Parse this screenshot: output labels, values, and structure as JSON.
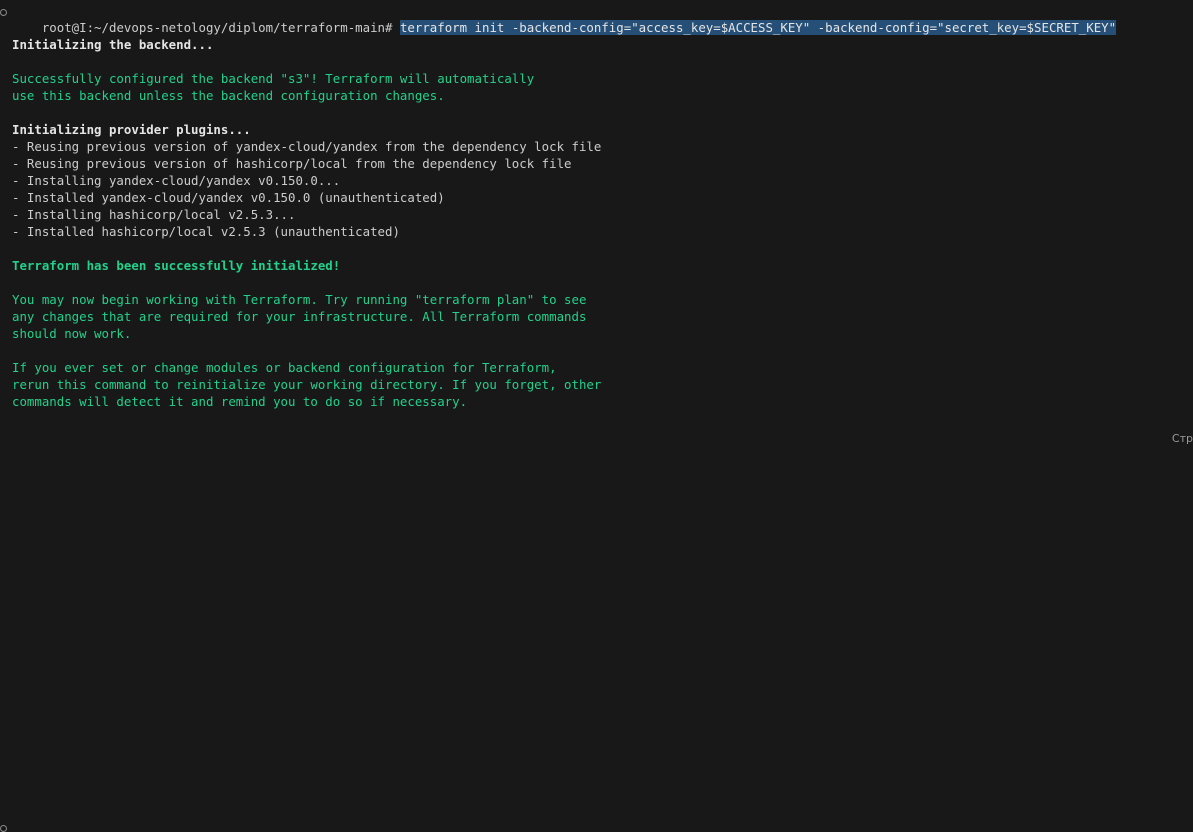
{
  "terminal": {
    "prompt": "root@I:~/devops-netology/diplom/terraform-main#",
    "command": "terraform init -backend-config=\"access_key=$ACCESS_KEY\" -backend-config=\"secret_key=$SECRET_KEY\"",
    "init_backend": "Initializing the backend...",
    "backend_ok_1": "Successfully configured the backend \"s3\"! Terraform will automatically",
    "backend_ok_2": "use this backend unless the backend configuration changes.",
    "init_plugins": "Initializing provider plugins...",
    "plugin_1": "- Reusing previous version of yandex-cloud/yandex from the dependency lock file",
    "plugin_2": "- Reusing previous version of hashicorp/local from the dependency lock file",
    "plugin_3": "- Installing yandex-cloud/yandex v0.150.0...",
    "plugin_4": "- Installed yandex-cloud/yandex v0.150.0 (unauthenticated)",
    "plugin_5": "- Installing hashicorp/local v2.5.3...",
    "plugin_6": "- Installed hashicorp/local v2.5.3 (unauthenticated)",
    "success": "Terraform has been successfully initialized!",
    "next_1": "You may now begin working with Terraform. Try running \"terraform plan\" to see",
    "next_2": "any changes that are required for your infrastructure. All Terraform commands",
    "next_3": "should now work.",
    "reinit_1": "If you ever set or change modules or backend configuration for Terraform,",
    "reinit_2": "rerun this command to reinitialize your working directory. If you forget, other",
    "reinit_3": "commands will detect it and remind you to do so if necessary."
  },
  "status_bar": {
    "partial_label": "Стр"
  },
  "colors": {
    "background": "#181818",
    "green_text": "#23d18b",
    "selection": "#264f78"
  }
}
